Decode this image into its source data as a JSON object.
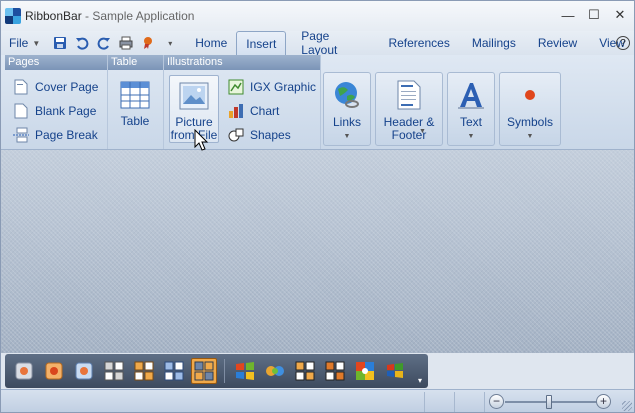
{
  "window": {
    "title_app": "RibbonBar",
    "title_separator": " - ",
    "title_doc": "Sample Application",
    "minimize": "—",
    "maximize": "☐",
    "close": "✕"
  },
  "menu": {
    "file_label": "File",
    "help_label": "?"
  },
  "tabs": [
    {
      "label": "Home",
      "active": false
    },
    {
      "label": "Insert",
      "active": true
    },
    {
      "label": "Page Layout",
      "active": false
    },
    {
      "label": "References",
      "active": false
    },
    {
      "label": "Mailings",
      "active": false
    },
    {
      "label": "Review",
      "active": false
    },
    {
      "label": "View",
      "active": false
    }
  ],
  "ribbon": {
    "groups": {
      "pages": {
        "caption": "Pages",
        "items": [
          {
            "label": "Cover Page",
            "icon": "cover-page-icon"
          },
          {
            "label": "Blank Page",
            "icon": "blank-page-icon"
          },
          {
            "label": "Page Break",
            "icon": "page-break-icon"
          }
        ]
      },
      "table": {
        "caption": "Table",
        "items": [
          {
            "label": "Table",
            "icon": "table-icon"
          }
        ]
      },
      "illustrations": {
        "caption": "Illustrations",
        "picture_line1": "Picture",
        "picture_line2": "from File",
        "items": [
          {
            "label": "IGX Graphic",
            "icon": "igx-graphic-icon"
          },
          {
            "label": "Chart",
            "icon": "chart-icon"
          },
          {
            "label": "Shapes",
            "icon": "shapes-icon"
          }
        ]
      }
    },
    "launchers": [
      {
        "line1": "Links",
        "line2": "",
        "icon": "globe-link-icon"
      },
      {
        "line1": "Header &",
        "line2": "Footer",
        "icon": "header-footer-icon"
      },
      {
        "line1": "Text",
        "line2": "",
        "icon": "text-icon"
      },
      {
        "line1": "Symbols",
        "line2": "",
        "icon": "symbol-icon"
      }
    ]
  },
  "colors": {
    "accent": "#15428b",
    "active_toolbar_button": "#f0a94a",
    "toolbar_background": "#4a586e"
  }
}
